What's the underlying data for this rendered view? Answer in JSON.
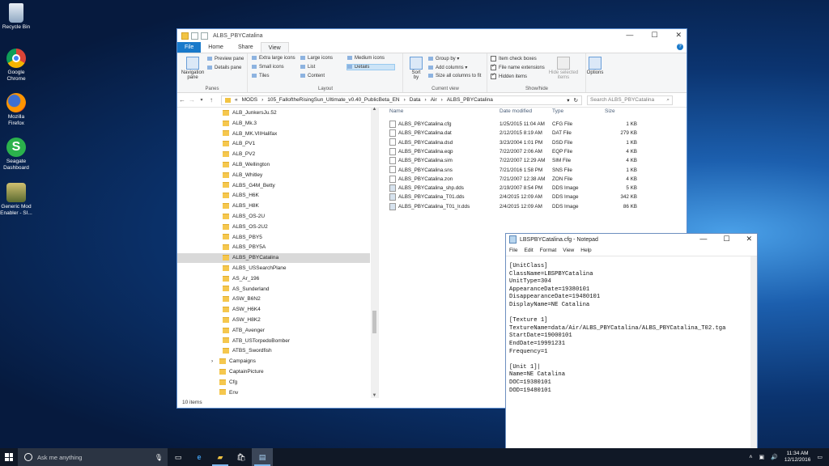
{
  "desktop": {
    "icons": [
      {
        "label": "Recycle Bin"
      },
      {
        "label": "Google Chrome"
      },
      {
        "label": "Mozilla Firefox"
      },
      {
        "label": "Seagate Dashboard"
      },
      {
        "label": "Generic Mod Enabler - SI..."
      }
    ]
  },
  "explorer": {
    "title": "ALBS_PBYCatalina",
    "tabs": {
      "file": "File",
      "home": "Home",
      "share": "Share",
      "view": "View"
    },
    "ribbon": {
      "panes": {
        "nav_line1": "Navigation",
        "nav_line2": "pane",
        "preview": "Preview pane",
        "details": "Details pane",
        "label": "Panes"
      },
      "layout": {
        "extra_large": "Extra large icons",
        "large": "Large icons",
        "medium": "Medium icons",
        "small": "Small icons",
        "list": "List",
        "details": "Details",
        "tiles": "Tiles",
        "content": "Content",
        "label": "Layout"
      },
      "current_view": {
        "sort_line1": "Sort",
        "sort_line2": "by",
        "group_by": "Group by",
        "add_columns": "Add columns",
        "size_all": "Size all columns to fit",
        "label": "Current view"
      },
      "show_hide": {
        "item_check": "Item check boxes",
        "file_ext": "File name extensions",
        "hidden": "Hidden items",
        "hide_sel_line1": "Hide selected",
        "hide_sel_line2": "items",
        "label": "Show/hide",
        "item_check_on": false,
        "file_ext_on": true,
        "hidden_on": true
      },
      "options": {
        "label": "Options"
      }
    },
    "address": {
      "prefix": "«",
      "segments": [
        "MODS",
        "105_FalloftheRisingSun_Ultimate_v0.40_PublicBeta_EN",
        "Data",
        "Air",
        "ALBS_PBYCatalina"
      ],
      "separator": "›"
    },
    "search_placeholder": "Search ALBS_PBYCatalina",
    "nav_items": [
      {
        "label": "ALB_JunkersJu.52",
        "indent": 1
      },
      {
        "label": "ALB_Mk.3",
        "indent": 1
      },
      {
        "label": "ALB_MK.VIIHalifax",
        "indent": 1
      },
      {
        "label": "ALB_PV1",
        "indent": 1
      },
      {
        "label": "ALB_PV2",
        "indent": 1
      },
      {
        "label": "ALB_Wellington",
        "indent": 1
      },
      {
        "label": "ALB_Whitley",
        "indent": 1
      },
      {
        "label": "ALBS_G4M_Betty",
        "indent": 1
      },
      {
        "label": "ALBS_H6K",
        "indent": 1
      },
      {
        "label": "ALBS_H8K",
        "indent": 1
      },
      {
        "label": "ALBS_OS-2U",
        "indent": 1
      },
      {
        "label": "ALBS_OS-2U2",
        "indent": 1
      },
      {
        "label": "ALBS_PBY5",
        "indent": 1
      },
      {
        "label": "ALBS_PBY5A",
        "indent": 1
      },
      {
        "label": "ALBS_PBYCatalina",
        "indent": 1,
        "selected": true
      },
      {
        "label": "ALBS_USSearchPlane",
        "indent": 1
      },
      {
        "label": "AS_Ar_196",
        "indent": 1
      },
      {
        "label": "AS_Sunderland",
        "indent": 1
      },
      {
        "label": "ASW_B6N2",
        "indent": 1
      },
      {
        "label": "ASW_H6K4",
        "indent": 1
      },
      {
        "label": "ASW_H8K2",
        "indent": 1
      },
      {
        "label": "ATB_Avenger",
        "indent": 1
      },
      {
        "label": "ATB_USTorpedoBomber",
        "indent": 1
      },
      {
        "label": "ATBS_Swordfish",
        "indent": 1
      },
      {
        "label": "Campaigns",
        "indent": 0,
        "expandable": true
      },
      {
        "label": "CaptainPicture",
        "indent": 0
      },
      {
        "label": "Cfg",
        "indent": 0
      },
      {
        "label": "Env",
        "indent": 0
      }
    ],
    "columns": {
      "name": "Name",
      "date": "Date modified",
      "type": "Type",
      "size": "Size"
    },
    "files": [
      {
        "name": "ALBS_PBYCatalina.cfg",
        "date": "1/25/2015 11:04 AM",
        "type": "CFG File",
        "size": "1 KB"
      },
      {
        "name": "ALBS_PBYCatalina.dat",
        "date": "2/12/2015 8:19 AM",
        "type": "DAT File",
        "size": "279 KB"
      },
      {
        "name": "ALBS_PBYCatalina.dsd",
        "date": "3/23/2004 1:01 PM",
        "type": "DSD File",
        "size": "1 KB"
      },
      {
        "name": "ALBS_PBYCatalina.eqp",
        "date": "7/22/2007 2:06 AM",
        "type": "EQP File",
        "size": "4 KB"
      },
      {
        "name": "ALBS_PBYCatalina.sim",
        "date": "7/22/2007 12:29 AM",
        "type": "SIM File",
        "size": "4 KB"
      },
      {
        "name": "ALBS_PBYCatalina.sns",
        "date": "7/21/2016 1:58 PM",
        "type": "SNS File",
        "size": "1 KB"
      },
      {
        "name": "ALBS_PBYCatalina.zon",
        "date": "7/21/2007 12:38 AM",
        "type": "ZON File",
        "size": "4 KB"
      },
      {
        "name": "ALBS_PBYCatalina_shp.dds",
        "date": "2/19/2007 8:54 PM",
        "type": "DDS Image",
        "size": "5 KB"
      },
      {
        "name": "ALBS_PBYCatalina_T01.dds",
        "date": "2/4/2015 12:09 AM",
        "type": "DDS Image",
        "size": "342 KB"
      },
      {
        "name": "ALBS_PBYCatalina_T01_lr.dds",
        "date": "2/4/2015 12:09 AM",
        "type": "DDS Image",
        "size": "86 KB"
      }
    ],
    "status": "10 items"
  },
  "notepad": {
    "title": "LBSPBYCatalina.cfg - Notepad",
    "menu": [
      "File",
      "Edit",
      "Format",
      "View",
      "Help"
    ],
    "text": "[UnitClass]\nClassName=LBSPBYCatalina\nUnitType=304\nAppearanceDate=19380101\nDisappearanceDate=19480101\nDisplayName=NE Catalina\n\n[Texture 1]\nTextureName=data/Air/ALBS_PBYCatalina/ALBS_PBYCatalina_T02.tga\nStartDate=19000101\nEndDate=19991231\nFrequency=1\n\n[Unit 1]|\nName=NE Catalina\nDOC=19380101\nDOD=19480101"
  },
  "taskbar": {
    "search_placeholder": "Ask me anything",
    "time": "11:34 AM",
    "date": "12/12/2016"
  }
}
